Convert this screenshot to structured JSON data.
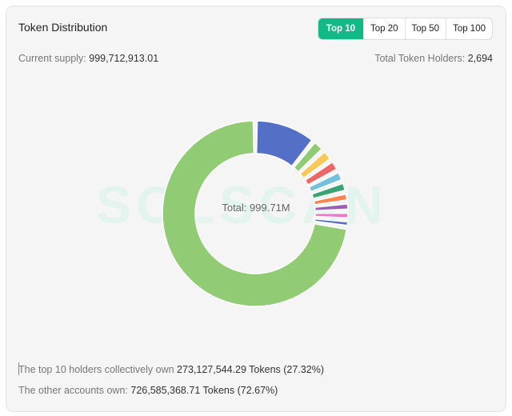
{
  "header": {
    "title": "Token Distribution",
    "tabs": [
      {
        "label": "Top 10",
        "active": true
      },
      {
        "label": "Top 20",
        "active": false
      },
      {
        "label": "Top 50",
        "active": false
      },
      {
        "label": "Top 100",
        "active": false
      }
    ]
  },
  "stats": {
    "supply_label": "Current supply:",
    "supply_value": "999,712,913.01",
    "holders_label": "Total Token Holders:",
    "holders_value": "2,694"
  },
  "watermark": "SOLSCAN",
  "chart_data": {
    "type": "pie",
    "center_label": "Total:",
    "center_value": "999.71M",
    "slices": [
      {
        "color": "#5470c6",
        "value": 10.8
      },
      {
        "color": "#91cc75",
        "value": 2.3
      },
      {
        "color": "#fac858",
        "value": 2.2
      },
      {
        "color": "#ee6666",
        "value": 2.1
      },
      {
        "color": "#73c0de",
        "value": 2.0
      },
      {
        "color": "#3ba272",
        "value": 1.9
      },
      {
        "color": "#fc8452",
        "value": 1.7
      },
      {
        "color": "#9a60b4",
        "value": 1.6
      },
      {
        "color": "#ea7ccc",
        "value": 1.5
      },
      {
        "color": "#5470c6",
        "value": 1.3
      },
      {
        "color": "#91cc75",
        "value": 72.67
      }
    ]
  },
  "summary": {
    "top_text": "The top 10 holders collectively own",
    "top_value": "273,127,544.29 Tokens (27.32%)",
    "other_text": "The other accounts own:",
    "other_value": "726,585,368.71 Tokens (72.67%)"
  }
}
